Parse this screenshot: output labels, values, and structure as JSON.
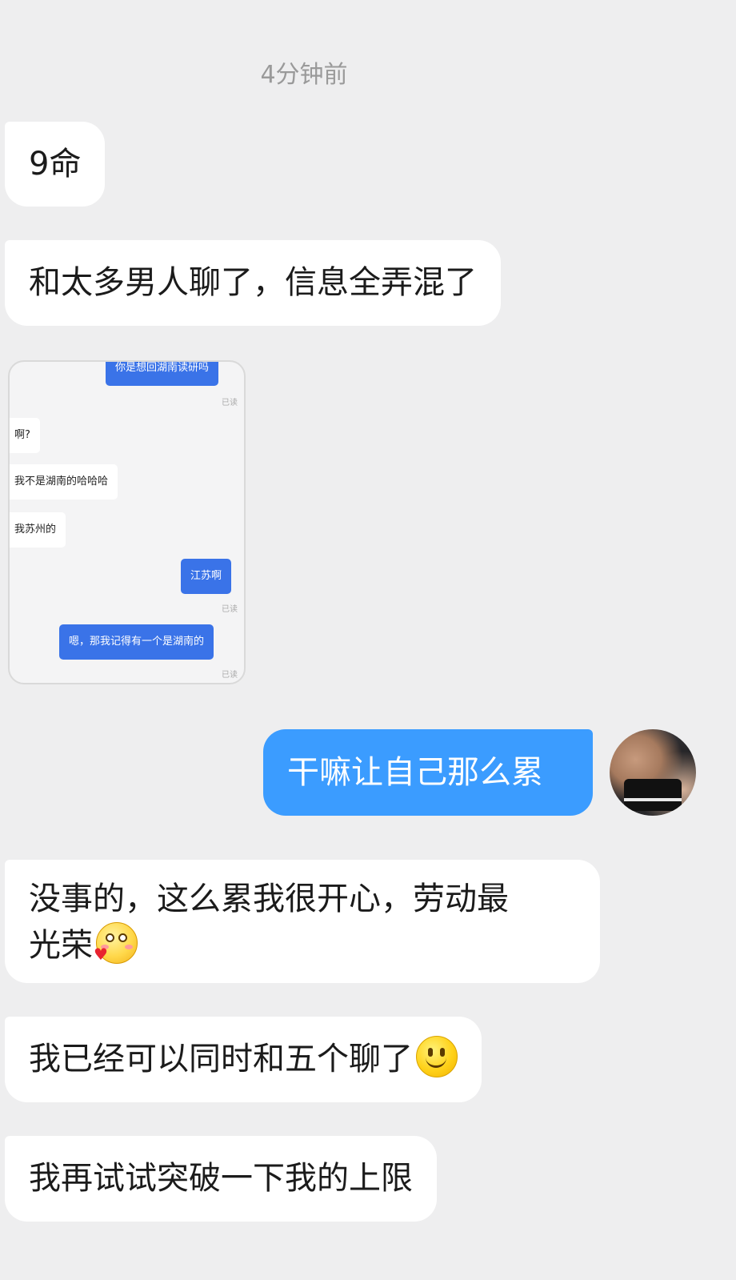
{
  "timestamp": "4分钟前",
  "messages": {
    "m1": "9命",
    "m2": "和太多男人聊了，信息全弄混了",
    "m4": "干嘛让自己那么累",
    "m5_line1": "没事的，这么累我很开心，劳动最",
    "m5_line2": "光荣",
    "m6": "我已经可以同时和五个聊了",
    "m7": "我再试试突破一下我的上限"
  },
  "emojis": {
    "m5": "shy-blushing-heart-icon",
    "m6": "smile-icon"
  },
  "shared_screenshot": {
    "bubbles": [
      {
        "side": "out",
        "text": "你是想回湖南读研吗"
      },
      {
        "side": "read",
        "text": "已读"
      },
      {
        "side": "in",
        "text": "啊?"
      },
      {
        "side": "in",
        "text": "我不是湖南的哈哈哈"
      },
      {
        "side": "in",
        "text": "我苏州的"
      },
      {
        "side": "out",
        "text": "江苏啊"
      },
      {
        "side": "read",
        "text": "已读"
      },
      {
        "side": "out",
        "text": "嗯，那我记得有一个是湖南的"
      },
      {
        "side": "read",
        "text": "已读"
      }
    ]
  },
  "colors": {
    "background": "#eeeeef",
    "incoming_bubble": "#ffffff",
    "outgoing_bubble": "#3b9cff",
    "timestamp_text": "#9a9a9a"
  }
}
